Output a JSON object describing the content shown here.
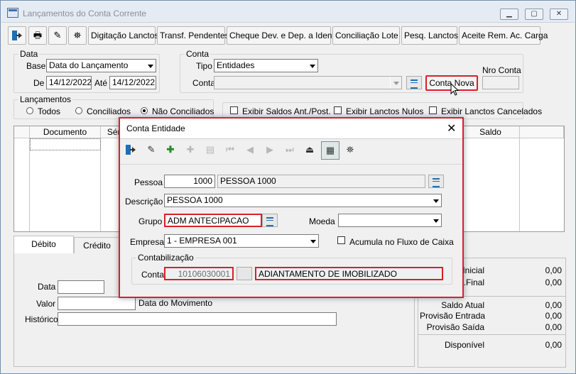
{
  "window": {
    "title": "Lançamentos do Conta Corrente"
  },
  "toolbar": {
    "buttons": [
      "Digitação Lanctos.",
      "Transf. Pendentes",
      "Cheque Dev. e Dep. a Ident.",
      "Conciliação Lote",
      "Pesq. Lanctos.",
      "Aceite Rem. Ac. Carga"
    ]
  },
  "data_group": {
    "legend": "Data",
    "base_label": "Base",
    "base_value": "Data do Lançamento",
    "de_label": "De",
    "de_value": "14/12/2022",
    "ate_label": "Até",
    "ate_value": "14/12/2022"
  },
  "conta_group": {
    "legend": "Conta",
    "tipo_label": "Tipo",
    "tipo_value": "Entidades",
    "conta_label": "Conta",
    "conta_value": "",
    "nova_button": "Conta Nova",
    "nro_conta_label": "Nro Conta",
    "nro_conta_value": ""
  },
  "lanc_group": {
    "legend": "Lançamentos",
    "opt_todos": "Todos",
    "opt_conciliados": "Conciliados",
    "opt_nao": "Não Conciliados",
    "selected": "Não Conciliados"
  },
  "checks": {
    "saldos": "Exibir Saldos Ant./Post.",
    "nulos": "Exibir Lanctos  Nulos",
    "cancelados": "Exibir Lanctos  Cancelados"
  },
  "grid": {
    "columns": [
      "Documento",
      "Séri",
      "Saldo"
    ]
  },
  "bottom_tabs": [
    "Débito",
    "Crédito"
  ],
  "bottom_form": {
    "data_label": "Data",
    "valor_label": "Valor",
    "data_mov": "Data do Movimento",
    "historico_label": "Histórico"
  },
  "saldos": {
    "rows": [
      {
        "label": "Inicial",
        "value": "0,00"
      },
      {
        "label": "t.Final",
        "value": "0,00"
      },
      {
        "label": "Saldo Atual",
        "value": "0,00"
      },
      {
        "label": "Provisão Entrada",
        "value": "0,00"
      },
      {
        "label": "Provisão Saída",
        "value": "0,00"
      },
      {
        "label": "Disponível",
        "value": "0,00"
      }
    ]
  },
  "dialog": {
    "title": "Conta Entidade",
    "pessoa_label": "Pessoa",
    "pessoa_code": "1000",
    "pessoa_name": "PESSOA 1000",
    "descricao_label": "Descrição",
    "descricao_value": "PESSOA 1000",
    "grupo_label": "Grupo",
    "grupo_value": "ADM ANTECIPACAO",
    "moeda_label": "Moeda",
    "moeda_value": "",
    "empresa_label": "Empresa",
    "empresa_value": "1 - EMPRESA 001",
    "acumula_label": "Acumula no Fluxo de Caixa",
    "contab_legend": "Contabilização",
    "conta_label": "Conta",
    "conta_code": "10106030001",
    "conta_desc": "ADIANTAMENTO DE IMOBILIZADO"
  },
  "colors": {
    "highlight": "#d9202a",
    "titlebar": "#e5ebf3"
  }
}
